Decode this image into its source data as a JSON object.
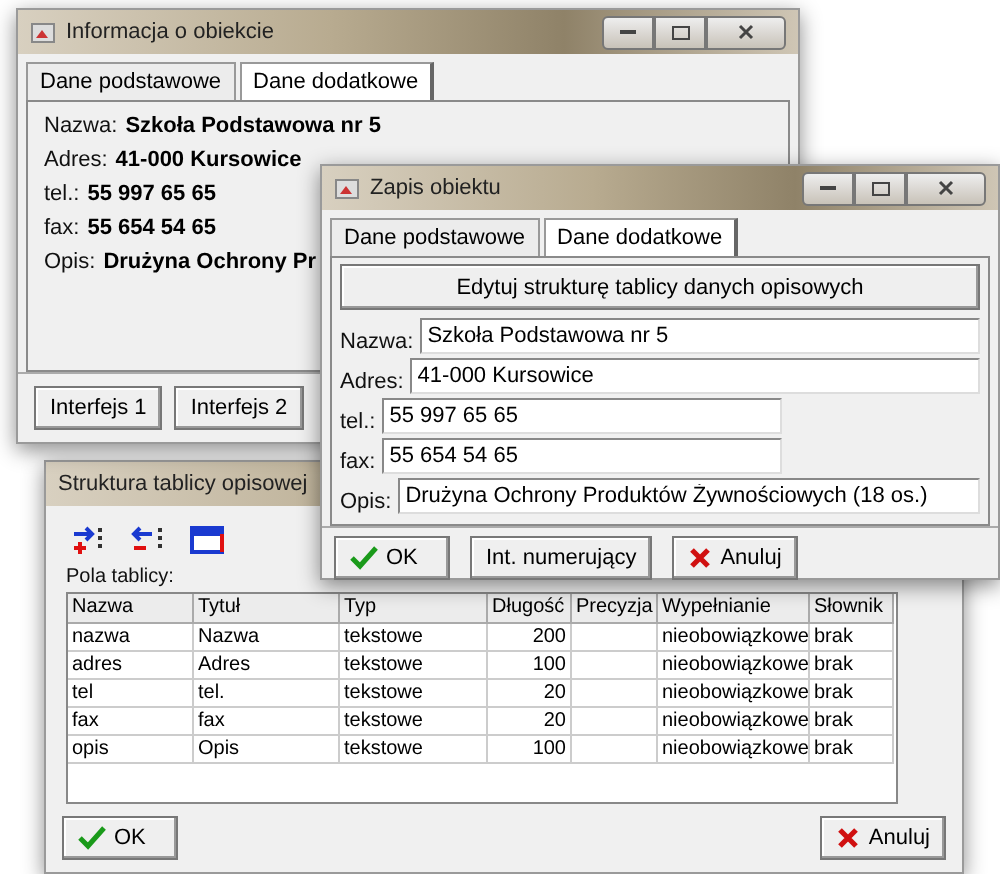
{
  "info_window": {
    "title": "Informacja o obiekcie",
    "tabs": [
      {
        "label": "Dane podstawowe",
        "selected": false
      },
      {
        "label": "Dane dodatkowe",
        "selected": true
      }
    ],
    "fields": [
      {
        "label": "Nazwa:",
        "value": "Szkoła Podstawowa nr 5"
      },
      {
        "label": "Adres:",
        "value": "41-000 Kursowice"
      },
      {
        "label": "tel.:",
        "value": "55 997 65 65"
      },
      {
        "label": "fax:",
        "value": "55 654 54 65"
      },
      {
        "label": "Opis:",
        "value": "Drużyna Ochrony Pr"
      }
    ],
    "buttons": [
      "Interfejs 1",
      "Interfejs 2"
    ]
  },
  "record_window": {
    "title": "Zapis obiektu",
    "tabs": [
      {
        "label": "Dane podstawowe",
        "selected": false
      },
      {
        "label": "Dane dodatkowe",
        "selected": true
      }
    ],
    "edit_button": "Edytuj strukturę tablicy danych opisowych",
    "fields": [
      {
        "label": "Nazwa:",
        "value": "Szkoła Podstawowa nr 5",
        "kind": "wide"
      },
      {
        "label": "Adres:",
        "value": "41-000 Kursowice",
        "kind": "wide"
      },
      {
        "label": "tel.:",
        "value": "55 997 65 65",
        "kind": "narrow"
      },
      {
        "label": "fax:",
        "value": "55 654 54 65",
        "kind": "narrow"
      },
      {
        "label": "Opis:",
        "value": "Drużyna Ochrony Produktów Żywnościowych (18 os.)",
        "kind": "wide"
      }
    ],
    "buttons": [
      {
        "kind": "ok",
        "label": "OK"
      },
      {
        "kind": "plain",
        "label": "Int. numerujący"
      },
      {
        "kind": "cancel",
        "label": "Anuluj"
      }
    ]
  },
  "structure_window": {
    "title": "Struktura tablicy opisowej",
    "fields_label": "Pola tablicy:",
    "columns": [
      "Nazwa",
      "Tytuł",
      "Typ",
      "Długość",
      "Precyzja",
      "Wypełnianie",
      "Słownik"
    ],
    "rows": [
      [
        "nazwa",
        "Nazwa",
        "tekstowe",
        "200",
        "",
        "nieobowiązkowe",
        "brak"
      ],
      [
        "adres",
        "Adres",
        "tekstowe",
        "100",
        "",
        "nieobowiązkowe",
        "brak"
      ],
      [
        "tel",
        "tel.",
        "tekstowe",
        "20",
        "",
        "nieobowiązkowe",
        "brak"
      ],
      [
        "fax",
        "fax",
        "tekstowe",
        "20",
        "",
        "nieobowiązkowe",
        "brak"
      ],
      [
        "opis",
        "Opis",
        "tekstowe",
        "100",
        "",
        "nieobowiązkowe",
        "brak"
      ]
    ],
    "buttons": [
      {
        "kind": "ok",
        "label": "OK"
      },
      {
        "kind": "cancel",
        "label": "Anuluj"
      }
    ]
  }
}
